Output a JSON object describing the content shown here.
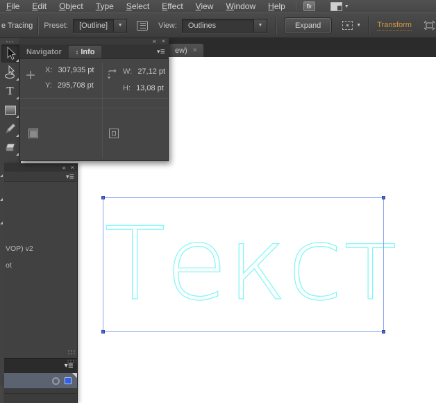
{
  "menu": {
    "items": [
      {
        "label": "File"
      },
      {
        "label": "Edit"
      },
      {
        "label": "Object"
      },
      {
        "label": "Type"
      },
      {
        "label": "Select"
      },
      {
        "label": "Effect"
      },
      {
        "label": "View"
      },
      {
        "label": "Window"
      },
      {
        "label": "Help"
      }
    ],
    "bridge_label": "Br"
  },
  "options": {
    "tool_label": "e Tracing",
    "preset_label": "Preset:",
    "preset_value": "[Outline]",
    "view_label": "View:",
    "view_value": "Outlines",
    "expand_label": "Expand",
    "transform_label": "Transform"
  },
  "doc_tab": {
    "label": "ew)",
    "close": "×"
  },
  "info_panel": {
    "collapse": "«",
    "close": "×",
    "menu_glyph": "▾≣",
    "tab_navigator": "Navigator",
    "tab_info_prefix": "↕",
    "tab_info": "Info",
    "x_label": "X:",
    "x_value": "307,935 pt",
    "y_label": "Y:",
    "y_value": "295,708 pt",
    "w_label": "W:",
    "w_value": "27,12 pt",
    "h_label": "H:",
    "h_value": "13,08 pt",
    "crosshair_glyph": "+"
  },
  "dock": {
    "collapse": "«",
    "close": "×",
    "menu_glyph": "▾≣",
    "line1": "VOP) v2",
    "line2": "ot"
  },
  "tools": {
    "type_glyph": "T"
  },
  "canvas": {
    "artwork_text": "Текст"
  },
  "colors": {
    "selection_border": "#8ca6f0",
    "selection_handle": "#4668d9",
    "artwork_outline": "#79f7f7",
    "transform_link": "#d89a3e",
    "layer_row": "#5b6270",
    "layer_selection_square": "#2e63e6",
    "canvas_bg": "#ffffff",
    "ui_bg": "#474747"
  }
}
